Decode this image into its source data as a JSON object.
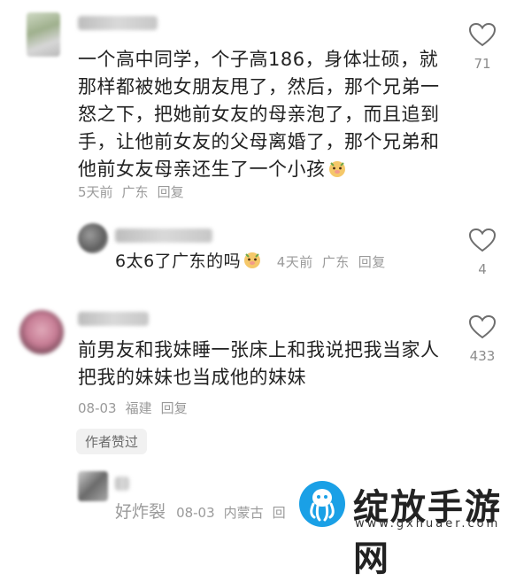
{
  "comments": [
    {
      "text": "一个高中同学，个子高186，身体壮硕，就那样都被她女朋友甩了，然后，那个兄弟一怒之下，把她前女友的母亲泡了，而且追到手，让他前女友的父母离婚了，那个兄弟和他前女友母亲还生了一个小孩",
      "line1": "一个高中同学，个子高186，身体壮硕，就",
      "line2": "那样都被她女朋友甩了，然后，那个兄弟一",
      "line3": "怒之下，把她前女友的母亲泡了，而且追到",
      "line4": "手，让他前女友的父母离婚了，那个兄弟和",
      "line5": "他前女友母亲还生了一个小孩",
      "time": "5天前",
      "location": "广东",
      "reply": "回复",
      "likes": "71"
    },
    {
      "text": "6太6了广东的吗",
      "time": "4天前",
      "location": "广东",
      "reply": "回复",
      "likes": "4"
    },
    {
      "line1": "前男友和我妹睡一张床上和我说把我当家人",
      "line2": "把我的妹妹也当成他的妹妹",
      "time": "08-03",
      "location": "福建",
      "reply": "回复",
      "likes": "433",
      "author_badge": "作者赞过"
    },
    {
      "text": "好炸裂",
      "time": "08-03",
      "location": "内蒙古",
      "reply": "回"
    }
  ],
  "watermark": {
    "title": "绽放手游网",
    "url": "www.gxhuaer.com"
  },
  "colors": {
    "text": "#222222",
    "meta": "#9a9a9a",
    "logo_blue": "#1aa0e6"
  }
}
